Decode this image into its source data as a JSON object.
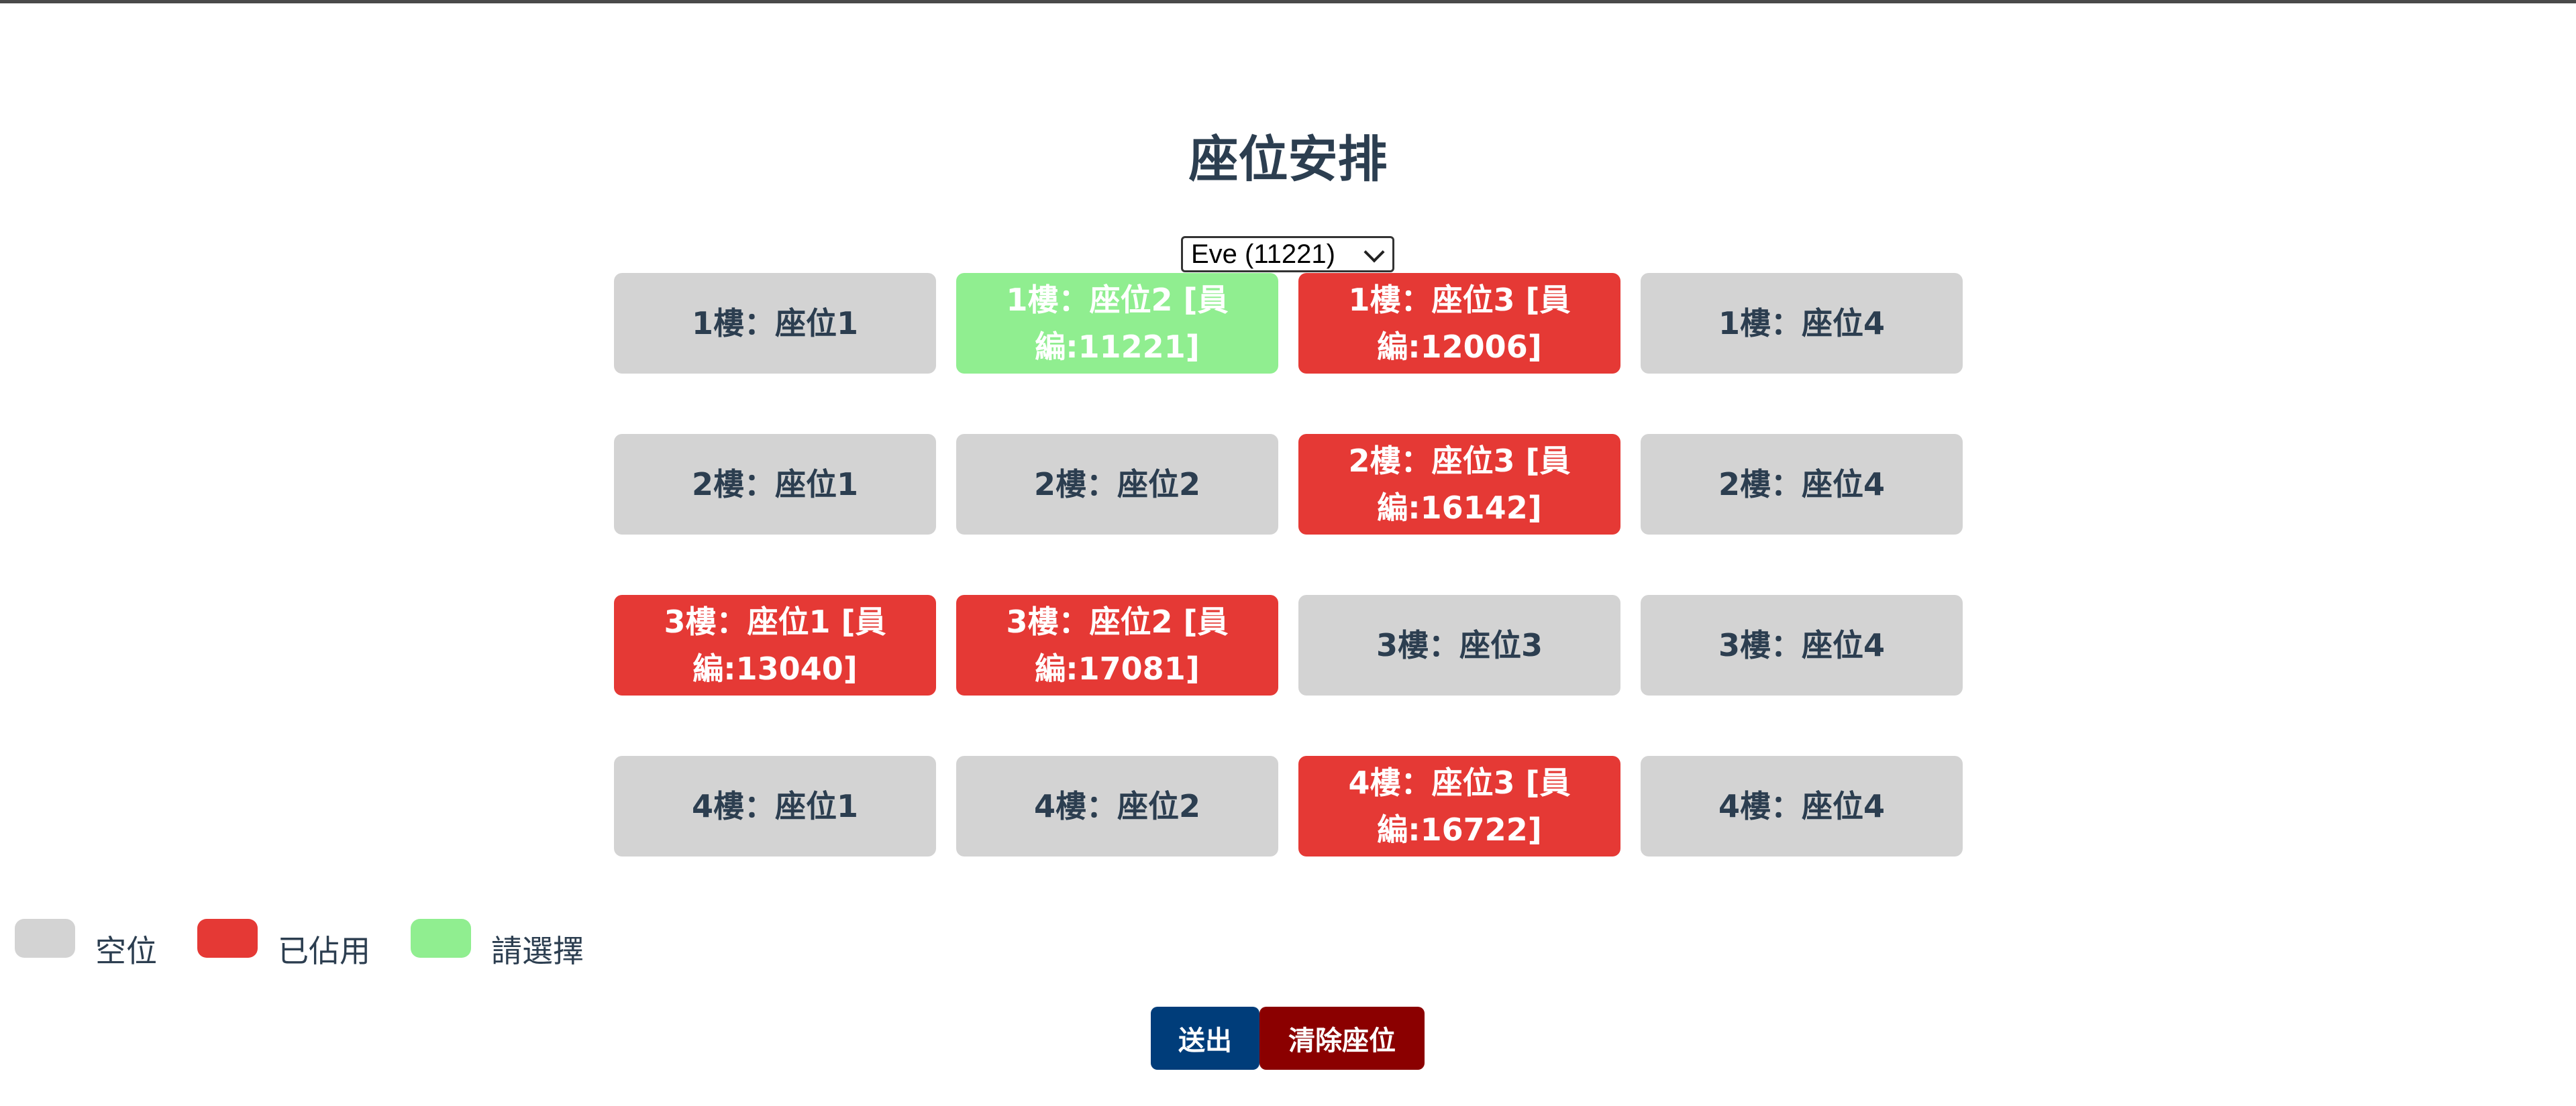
{
  "page": {
    "title": "座位安排"
  },
  "user_select": {
    "selected": "Eve (11221)"
  },
  "seats": [
    {
      "label": "1樓：座位1",
      "status": "empty"
    },
    {
      "label": "1樓：座位2 [員編:11221]",
      "status": "selected"
    },
    {
      "label": "1樓：座位3 [員編:12006]",
      "status": "occupied"
    },
    {
      "label": "1樓：座位4",
      "status": "empty"
    },
    {
      "label": "2樓：座位1",
      "status": "empty"
    },
    {
      "label": "2樓：座位2",
      "status": "empty"
    },
    {
      "label": "2樓：座位3 [員編:16142]",
      "status": "occupied"
    },
    {
      "label": "2樓：座位4",
      "status": "empty"
    },
    {
      "label": "3樓：座位1 [員編:13040]",
      "status": "occupied"
    },
    {
      "label": "3樓：座位2 [員編:17081]",
      "status": "occupied"
    },
    {
      "label": "3樓：座位3",
      "status": "empty"
    },
    {
      "label": "3樓：座位4",
      "status": "empty"
    },
    {
      "label": "4樓：座位1",
      "status": "empty"
    },
    {
      "label": "4樓：座位2",
      "status": "empty"
    },
    {
      "label": "4樓：座位3 [員編:16722]",
      "status": "occupied"
    },
    {
      "label": "4樓：座位4",
      "status": "empty"
    }
  ],
  "legend": [
    {
      "label": "空位",
      "color": "#d3d3d3"
    },
    {
      "label": "已佔用",
      "color": "#e53935"
    },
    {
      "label": "請選擇",
      "color": "#90ee90"
    }
  ],
  "actions": {
    "submit_label": "送出",
    "clear_label": "清除座位"
  },
  "colors": {
    "empty": "#d3d3d3",
    "occupied": "#e53935",
    "selected": "#90ee90",
    "submit": "#003d7a",
    "clear": "#8b0000",
    "title": "#2c3e50"
  }
}
